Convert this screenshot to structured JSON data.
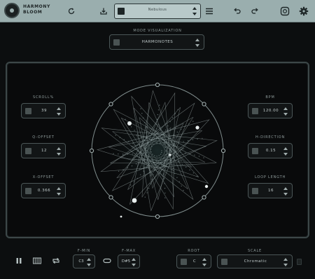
{
  "app": {
    "title_line1": "HARMONY",
    "title_line2": "BLOOM"
  },
  "topbar": {
    "preset_value": "Nebulous",
    "icons": [
      "refresh-icon",
      "save-icon",
      "dice-icon",
      "menu-icon",
      "undo-icon",
      "redo-icon",
      "settings-panel-icon",
      "gear-icon"
    ]
  },
  "mode": {
    "label": "MODE VISUALIZATION",
    "value": "HARMONOTES"
  },
  "left_params": [
    {
      "label": "SCROLL%",
      "value": "39"
    },
    {
      "label": "Q-OFFSET",
      "value": "12"
    },
    {
      "label": "X-OFFSET",
      "value": "0.366"
    }
  ],
  "right_params": [
    {
      "label": "BPM",
      "value": "120.00"
    },
    {
      "label": "H-DIRECTION",
      "value": "0.15"
    },
    {
      "label": "LOOP LENGTH",
      "value": "16"
    }
  ],
  "bottom": {
    "fmin_label": "F-MIN",
    "fmin_value": "C3",
    "fmax_label": "F-MAX",
    "fmax_value": "D#5",
    "root_label": "ROOT",
    "root_value": "C",
    "scale_label": "SCALE",
    "scale_value": "Chromatic"
  },
  "colors": {
    "topbar": "#9aaeae",
    "background": "#0c0e0f",
    "accent": "#c8d2d2"
  }
}
